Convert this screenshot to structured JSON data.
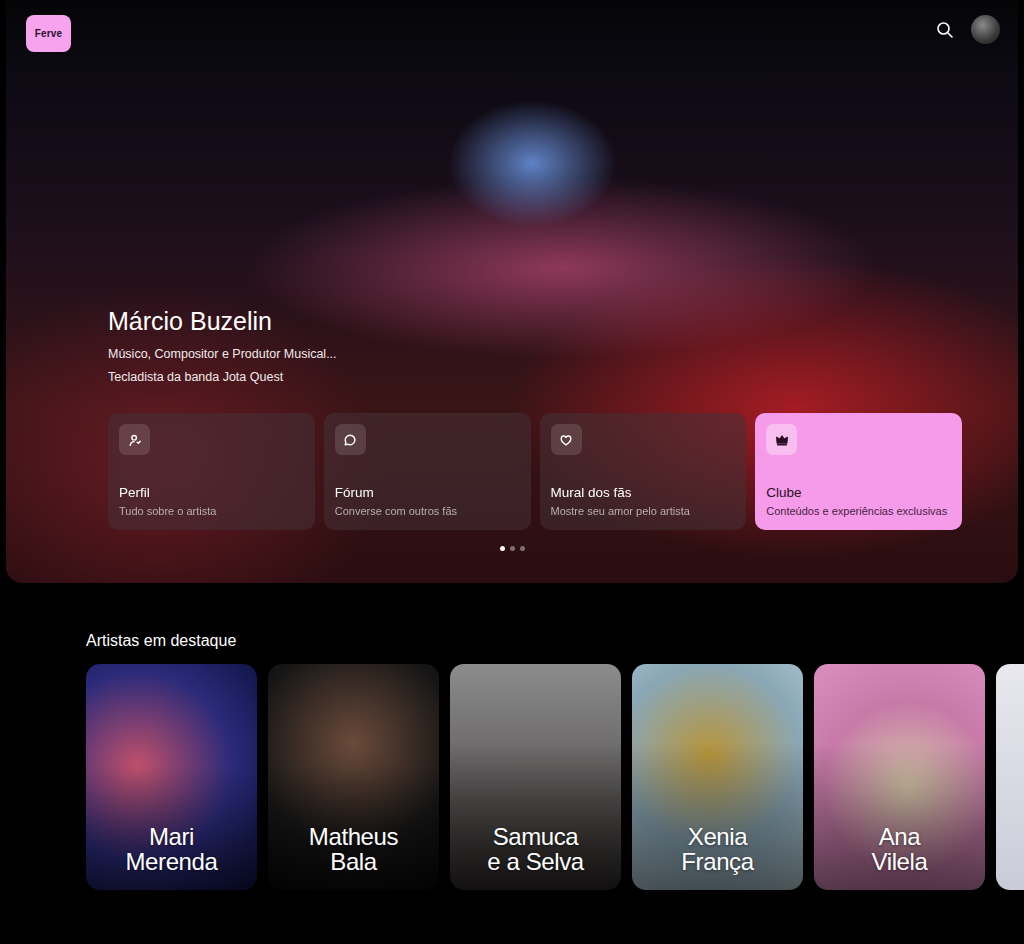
{
  "header": {
    "logo": "Ferve"
  },
  "hero": {
    "title": "Márcio Buzelin",
    "subtitle": "Músico, Compositor e Produtor Musical...",
    "role": "Tecladista da banda Jota Quest",
    "cards": [
      {
        "title": "Perfil",
        "caption": "Tudo sobre o artista",
        "selected": false
      },
      {
        "title": "Fórum",
        "caption": "Converse com outros fãs",
        "selected": false
      },
      {
        "title": "Mural dos fãs",
        "caption": "Mostre seu amor pelo artista",
        "selected": false
      },
      {
        "title": "Clube",
        "caption": "Conteúdos e experiências exclusivas",
        "selected": true
      }
    ],
    "dots": [
      {
        "selected": true
      },
      {
        "selected": false
      },
      {
        "selected": false
      }
    ]
  },
  "featured": {
    "heading": "Artistas em destaque",
    "artists": [
      {
        "name_lines": [
          "Mari",
          "Merenda"
        ]
      },
      {
        "name_lines": [
          "Matheus",
          "Bala"
        ]
      },
      {
        "name_lines": [
          "Samuca",
          "e a Selva"
        ]
      },
      {
        "name_lines": [
          "Xenia",
          "França"
        ]
      },
      {
        "name_lines": [
          "Ana",
          "Vilela"
        ]
      },
      {
        "name_lines": []
      }
    ]
  }
}
